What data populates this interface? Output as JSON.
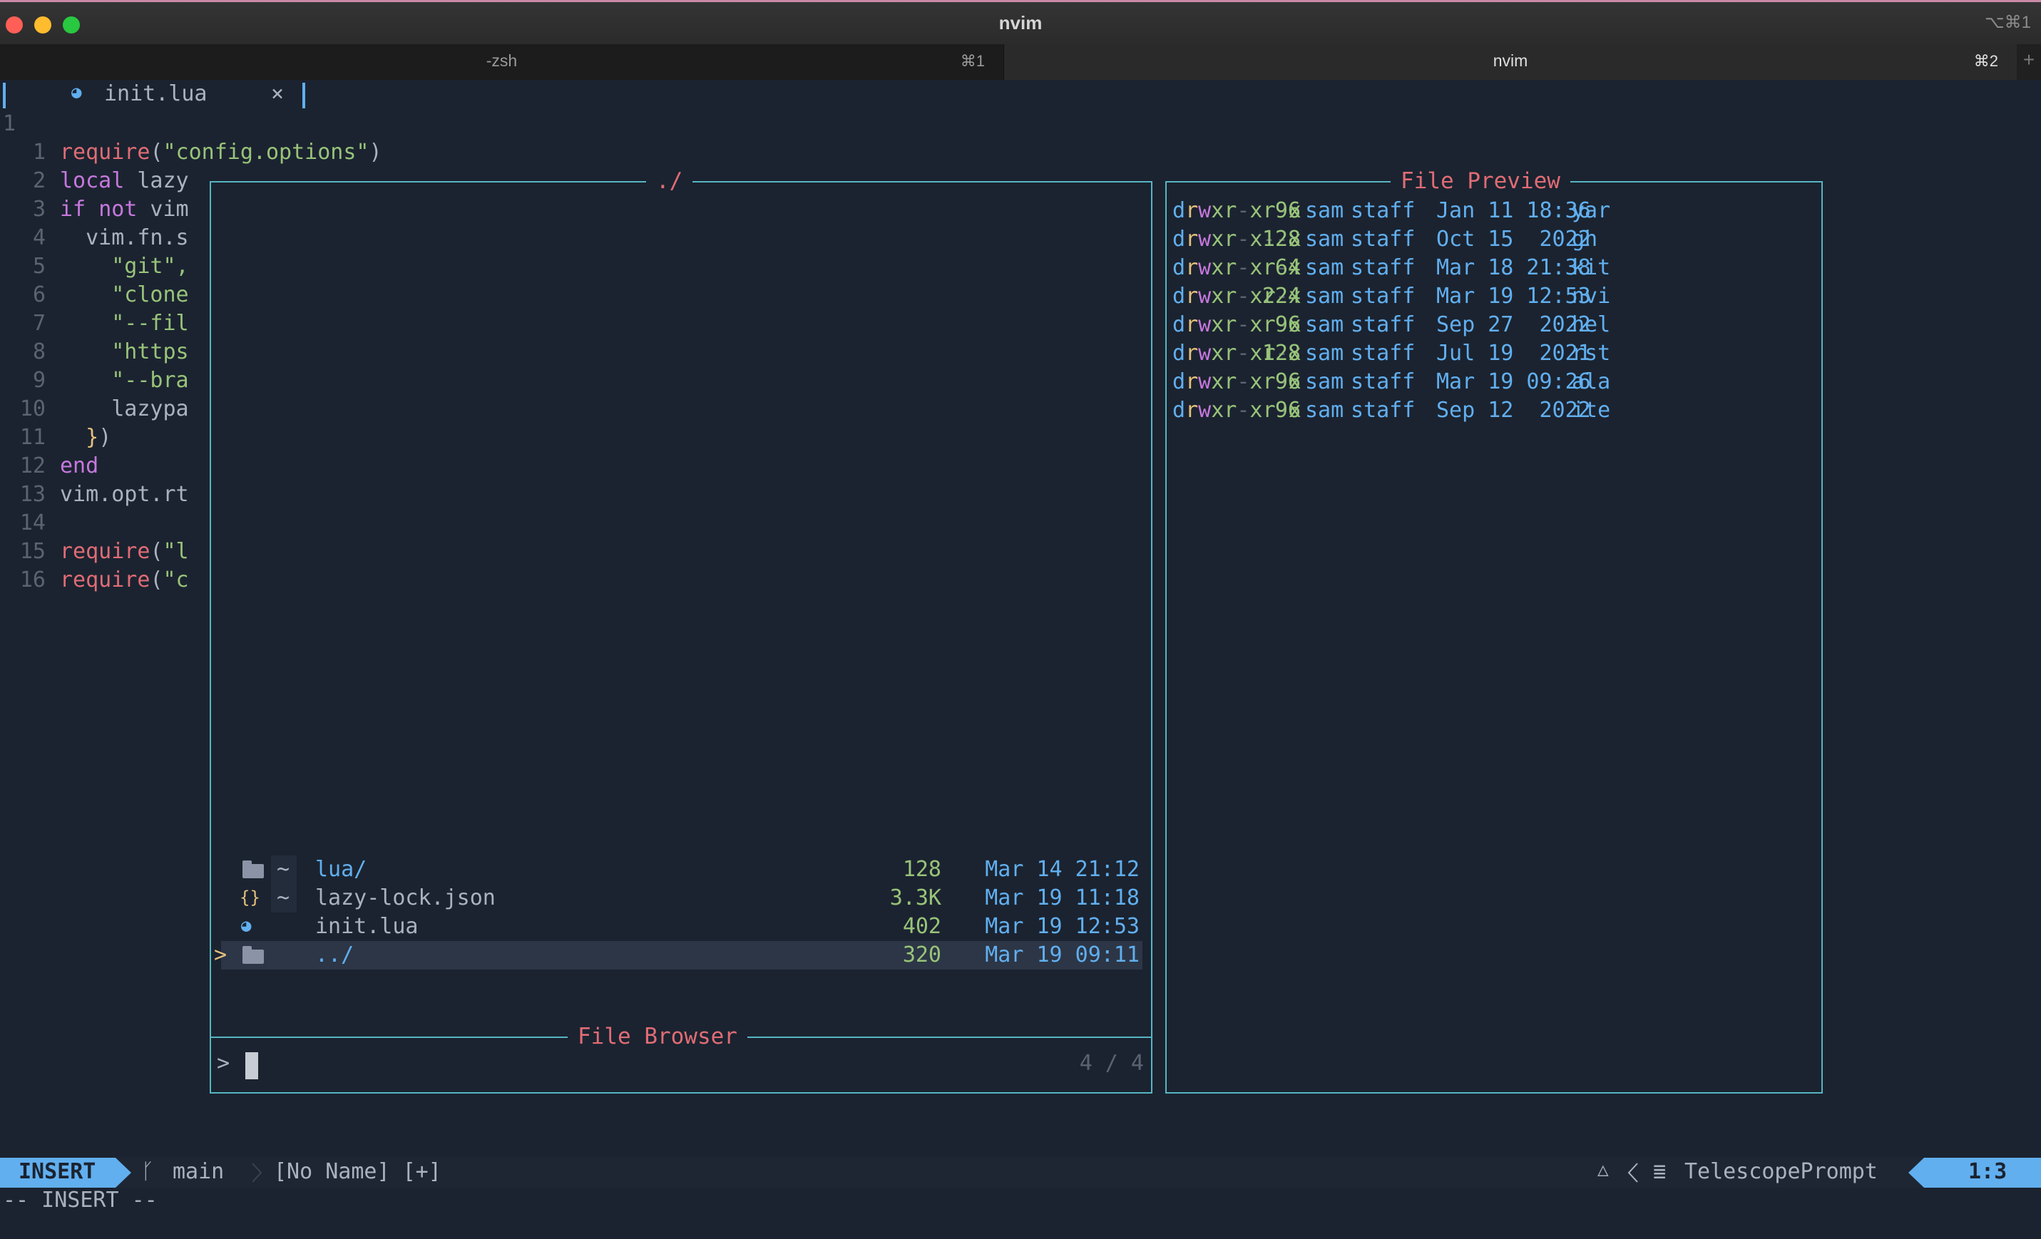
{
  "window": {
    "title": "nvim",
    "shortcut": "⌥⌘1",
    "tabs": [
      {
        "label": "-zsh",
        "key": "⌘1"
      },
      {
        "label": "nvim",
        "key": "⌘2"
      }
    ],
    "new_tab": "+"
  },
  "buffer_tab": {
    "filename": "init.lua",
    "close": "×"
  },
  "editor": {
    "top_line_number": "1",
    "lines": [
      {
        "n": "1",
        "tokens": [
          [
            "fn",
            "require"
          ],
          [
            "txt",
            "("
          ],
          [
            "str",
            "\"config.options\""
          ],
          [
            "txt",
            ")"
          ]
        ]
      },
      {
        "n": "2",
        "tokens": [
          [
            "kw",
            "local"
          ],
          [
            "txt",
            " lazy"
          ]
        ]
      },
      {
        "n": "3",
        "tokens": [
          [
            "kw",
            "if"
          ],
          [
            "txt",
            " "
          ],
          [
            "kw",
            "not"
          ],
          [
            "txt",
            " vim"
          ]
        ]
      },
      {
        "n": "4",
        "tokens": [
          [
            "txt",
            "  vim.fn.s"
          ]
        ]
      },
      {
        "n": "5",
        "tokens": [
          [
            "str",
            "    \"git\","
          ]
        ]
      },
      {
        "n": "6",
        "tokens": [
          [
            "str",
            "    \"clone"
          ]
        ]
      },
      {
        "n": "7",
        "tokens": [
          [
            "str",
            "    \"--fil"
          ]
        ]
      },
      {
        "n": "8",
        "tokens": [
          [
            "str",
            "    \"https"
          ]
        ]
      },
      {
        "n": "9",
        "tokens": [
          [
            "str",
            "    \"--bra"
          ]
        ]
      },
      {
        "n": "10",
        "tokens": [
          [
            "txt",
            "    lazypa"
          ]
        ]
      },
      {
        "n": "11",
        "tokens": [
          [
            "txt",
            "  "
          ],
          [
            "brk",
            "}"
          ],
          [
            "txt",
            ")"
          ]
        ]
      },
      {
        "n": "12",
        "tokens": [
          [
            "kw",
            "end"
          ]
        ]
      },
      {
        "n": "13",
        "tokens": [
          [
            "txt",
            "vim.opt.rt"
          ]
        ]
      },
      {
        "n": "14",
        "tokens": []
      },
      {
        "n": "15",
        "tokens": [
          [
            "fn",
            "require"
          ],
          [
            "txt",
            "("
          ],
          [
            "str",
            "\"l"
          ]
        ]
      },
      {
        "n": "16",
        "tokens": [
          [
            "fn",
            "require"
          ],
          [
            "txt",
            "("
          ],
          [
            "str",
            "\"c"
          ]
        ]
      }
    ]
  },
  "results_panel": {
    "title": "./",
    "rows": [
      {
        "prefix": "",
        "icon": "folder-icon",
        "glyph": "",
        "git": "~",
        "name": "lua/",
        "size": "128",
        "date": "Mar 14 21:12",
        "name_color": "#61afef",
        "selected": false
      },
      {
        "prefix": "",
        "icon": "json-icon",
        "glyph": "{}",
        "git": "~",
        "name": "lazy-lock.json",
        "size": "3.3K",
        "date": "Mar 19 11:18",
        "name_color": "#abb2bf",
        "selected": false
      },
      {
        "prefix": "",
        "icon": "lua-icon",
        "glyph": "",
        "git": "",
        "name": "init.lua",
        "size": "402",
        "date": "Mar 19 12:53",
        "name_color": "#abb2bf",
        "selected": false
      },
      {
        "prefix": ">",
        "icon": "folder-icon",
        "glyph": "",
        "git": "",
        "name": "../",
        "size": "320",
        "date": "Mar 19 09:11",
        "name_color": "#61afef",
        "selected": true
      }
    ]
  },
  "prompt_panel": {
    "title": "File Browser",
    "prefix": ">",
    "value": "",
    "counter": "4 / 4"
  },
  "preview_panel": {
    "title": "File Preview",
    "rows": [
      {
        "perm": [
          "d",
          "rwx",
          "r-x",
          "r-x"
        ],
        "size": "96",
        "user": "sam",
        "group": "staff",
        "date": "Jan 11 18:36",
        "name": "yar"
      },
      {
        "perm": [
          "d",
          "rwx",
          "r-x",
          "--x"
        ],
        "size": "128",
        "user": "sam",
        "group": "staff",
        "date": "Oct 15  2022",
        "name": "gh"
      },
      {
        "perm": [
          "d",
          "rwx",
          "r-x",
          "r-x"
        ],
        "size": "64",
        "user": "sam",
        "group": "staff",
        "date": "Mar 18 21:38",
        "name": "kit"
      },
      {
        "perm": [
          "d",
          "rwx",
          "r-x",
          "r-x"
        ],
        "size": "224",
        "user": "sam",
        "group": "staff",
        "date": "Mar 19 12:53",
        "name": "nvi"
      },
      {
        "perm": [
          "d",
          "rwx",
          "r-x",
          "r-x"
        ],
        "size": "96",
        "user": "sam",
        "group": "staff",
        "date": "Sep 27  2022",
        "name": "hel"
      },
      {
        "perm": [
          "d",
          "rwx",
          "r-x",
          "r-x"
        ],
        "size": "128",
        "user": "sam",
        "group": "staff",
        "date": "Jul 19  2021",
        "name": "rst"
      },
      {
        "perm": [
          "d",
          "rwx",
          "r-x",
          "r-x"
        ],
        "size": "96",
        "user": "sam",
        "group": "staff",
        "date": "Mar 19 09:26",
        "name": "ala"
      },
      {
        "perm": [
          "d",
          "rwx",
          "r-x",
          "r-x"
        ],
        "size": "96",
        "user": "sam",
        "group": "staff",
        "date": "Sep 12  2022",
        "name": "ite"
      }
    ]
  },
  "statusline": {
    "mode": "INSERT",
    "branch": "main",
    "buffer": "[No Name] [+]",
    "filetype": "TelescopePrompt",
    "position": "1:3"
  },
  "cmdline": {
    "text": "-- INSERT --"
  },
  "colors": {
    "border": "#56b6c2",
    "title": "#e06c75",
    "mode_bg": "#61afef",
    "folder": "#61afef",
    "size": "#98c379",
    "date": "#61afef",
    "keyword": "#c678dd",
    "string": "#98c379"
  }
}
